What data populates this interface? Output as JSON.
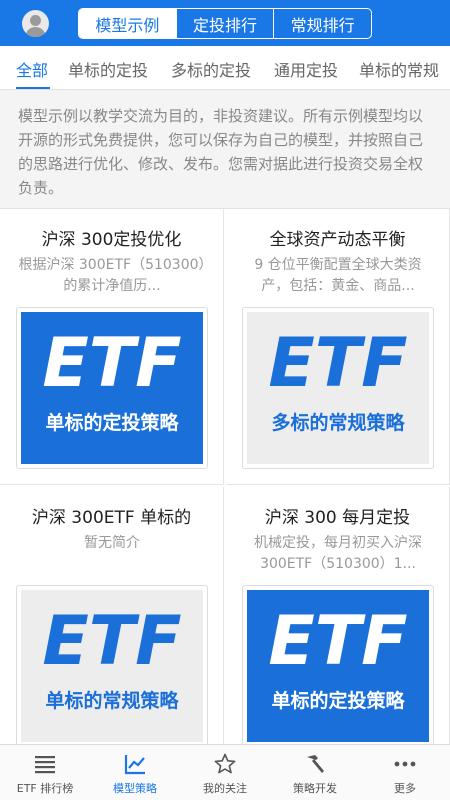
{
  "header": {
    "segments": [
      "模型示例",
      "定投排行",
      "常规排行"
    ],
    "active_segment": "模型示例"
  },
  "subtabs": [
    "全部",
    "单标的定投",
    "多标的定投",
    "通用定投",
    "单标的常规"
  ],
  "active_subtab": "全部",
  "notice": "模型示例以教学交流为目的，非投资建议。所有示例模型均以开源的形式免费提供，您可以保存为自己的模型，并按照自己的思路进行优化、修改、发布。您需对据此进行投资交易全权负责。",
  "cards": [
    {
      "title": "沪深 300定投优化",
      "desc": "根据沪深 300ETF（510300）的累计净值历...",
      "thumb_text": "ETF",
      "thumb_label": "单标的定投策略",
      "thumb_style": "blue"
    },
    {
      "title": "全球资产动态平衡",
      "desc": "9 仓位平衡配置全球大类资产，包括：黄金、商品...",
      "thumb_text": "ETF",
      "thumb_label": "多标的常规策略",
      "thumb_style": "gray"
    },
    {
      "title": "沪深 300ETF 单标的",
      "desc": "暂无简介",
      "thumb_text": "ETF",
      "thumb_label": "单标的常规策略",
      "thumb_style": "gray"
    },
    {
      "title": "沪深 300 每月定投",
      "desc": "机械定投，每月初买入沪深 300ETF（510300）1...",
      "thumb_text": "ETF",
      "thumb_label": "单标的定投策略",
      "thumb_style": "blue"
    }
  ],
  "tabbar": [
    {
      "label": "ETF 排行榜",
      "icon": "list-icon"
    },
    {
      "label": "模型策略",
      "icon": "chart-icon"
    },
    {
      "label": "我的关注",
      "icon": "star-icon"
    },
    {
      "label": "策略开发",
      "icon": "hammer-icon"
    },
    {
      "label": "更多",
      "icon": "more-icon"
    }
  ],
  "active_tab": "模型策略",
  "colors": {
    "brand": "#1a78e6",
    "thumb_blue": "#1a6fd8",
    "thumb_gray": "#ededed"
  }
}
